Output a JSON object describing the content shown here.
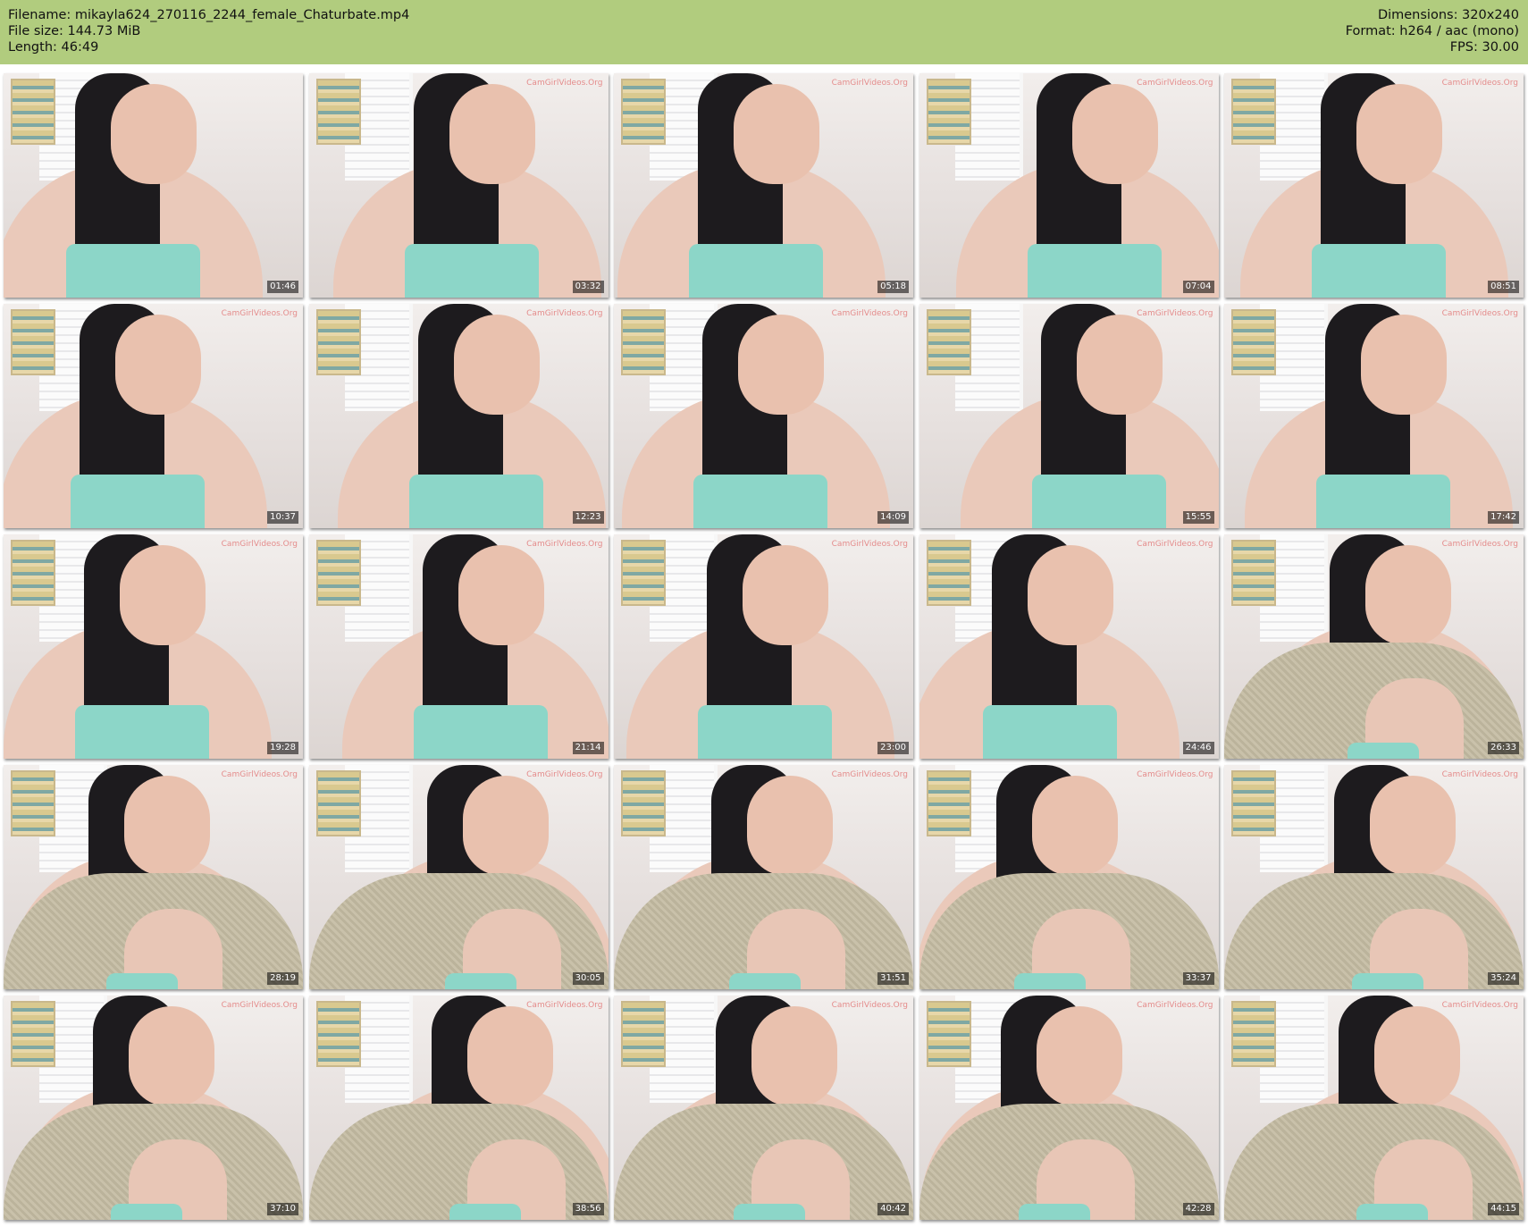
{
  "header": {
    "filename_line": "Filename: mikayla624_270116_2244_female_Chaturbate.mp4",
    "filesize_line": "File size: 144.73 MiB",
    "length_line": "Length: 46:49",
    "dimensions_line": "Dimensions: 320x240",
    "format_line": "Format: h264 / aac (mono)",
    "fps_line": "FPS: 30.00"
  },
  "watermark_text": "CamGirlVideos.Org",
  "thumbnails": [
    {
      "time": "01:46",
      "outfit": "tank",
      "watermark": false
    },
    {
      "time": "03:32",
      "outfit": "tank",
      "watermark": true
    },
    {
      "time": "05:18",
      "outfit": "tank",
      "watermark": true
    },
    {
      "time": "07:04",
      "outfit": "tank",
      "watermark": true
    },
    {
      "time": "08:51",
      "outfit": "tank",
      "watermark": true
    },
    {
      "time": "10:37",
      "outfit": "tank",
      "watermark": true
    },
    {
      "time": "12:23",
      "outfit": "tank",
      "watermark": true
    },
    {
      "time": "14:09",
      "outfit": "tank",
      "watermark": true
    },
    {
      "time": "15:55",
      "outfit": "tank",
      "watermark": true
    },
    {
      "time": "17:42",
      "outfit": "tank",
      "watermark": true
    },
    {
      "time": "19:28",
      "outfit": "tank",
      "watermark": true
    },
    {
      "time": "21:14",
      "outfit": "tank",
      "watermark": true
    },
    {
      "time": "23:00",
      "outfit": "tank",
      "watermark": true
    },
    {
      "time": "24:46",
      "outfit": "tank",
      "watermark": true
    },
    {
      "time": "26:33",
      "outfit": "sweater",
      "watermark": true
    },
    {
      "time": "28:19",
      "outfit": "sweater",
      "watermark": true
    },
    {
      "time": "30:05",
      "outfit": "sweater",
      "watermark": true
    },
    {
      "time": "31:51",
      "outfit": "sweater",
      "watermark": true
    },
    {
      "time": "33:37",
      "outfit": "sweater",
      "watermark": true
    },
    {
      "time": "35:24",
      "outfit": "sweater",
      "watermark": true
    },
    {
      "time": "37:10",
      "outfit": "sweater",
      "watermark": true
    },
    {
      "time": "38:56",
      "outfit": "sweater",
      "watermark": true
    },
    {
      "time": "40:42",
      "outfit": "sweater",
      "watermark": true
    },
    {
      "time": "42:28",
      "outfit": "sweater",
      "watermark": true
    },
    {
      "time": "44:15",
      "outfit": "sweater",
      "watermark": true
    }
  ],
  "colors": {
    "header_bg": "#b1cc7e",
    "tank_top": "#8cd6c8",
    "hair": "#1d1b1e"
  }
}
